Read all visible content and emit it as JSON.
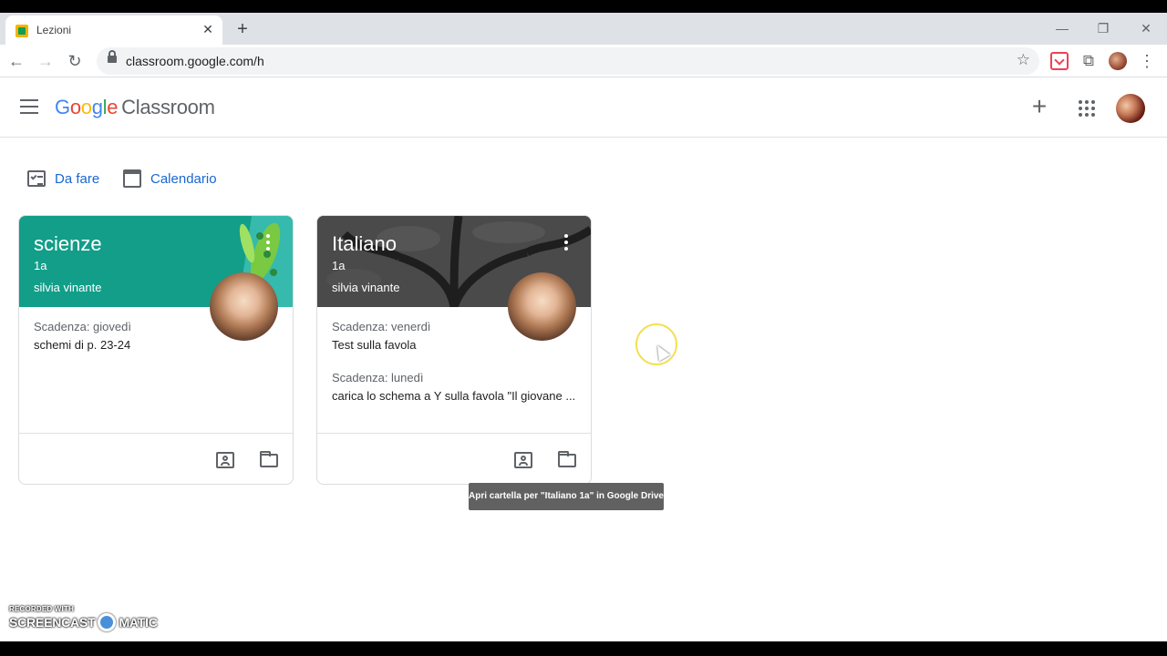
{
  "browser": {
    "tab_title": "Lezioni",
    "tab_close": "✕",
    "new_tab": "+",
    "window_controls": [
      "—",
      "❐",
      "✕"
    ],
    "url": "classroom.google.com/h",
    "nav": {
      "back": "←",
      "forward": "→",
      "reload": "↻"
    },
    "star": "☆",
    "puzzle": "⧉",
    "menu": "⋮"
  },
  "header": {
    "logo_letters": [
      "G",
      "o",
      "o",
      "g",
      "l",
      "e"
    ],
    "product": "Classroom",
    "create": "+"
  },
  "quick_links": {
    "todo": "Da fare",
    "calendar": "Calendario"
  },
  "cards": [
    {
      "title": "scienze",
      "section": "1a",
      "owner": "silvia vinante",
      "due": [
        {
          "label": "Scadenza: giovedì",
          "text": "schemi di p. 23-24"
        }
      ]
    },
    {
      "title": "Italiano",
      "section": "1a",
      "owner": "silvia vinante",
      "due": [
        {
          "label": "Scadenza: venerdì",
          "text": "Test sulla favola"
        },
        {
          "label": "Scadenza: lunedì",
          "text": "carica lo schema a Y sulla favola \"Il giovane ..."
        }
      ]
    }
  ],
  "tooltip": "Apri cartella per \"Italiano 1a\" in Google Drive",
  "watermark": {
    "top": "RECORDED WITH",
    "left": "SCREENCAST",
    "right": "MATIC"
  },
  "colors": {
    "accent": "#1967d2",
    "card_scienze": "#129e89",
    "card_italiano": "#3e3e3e"
  }
}
